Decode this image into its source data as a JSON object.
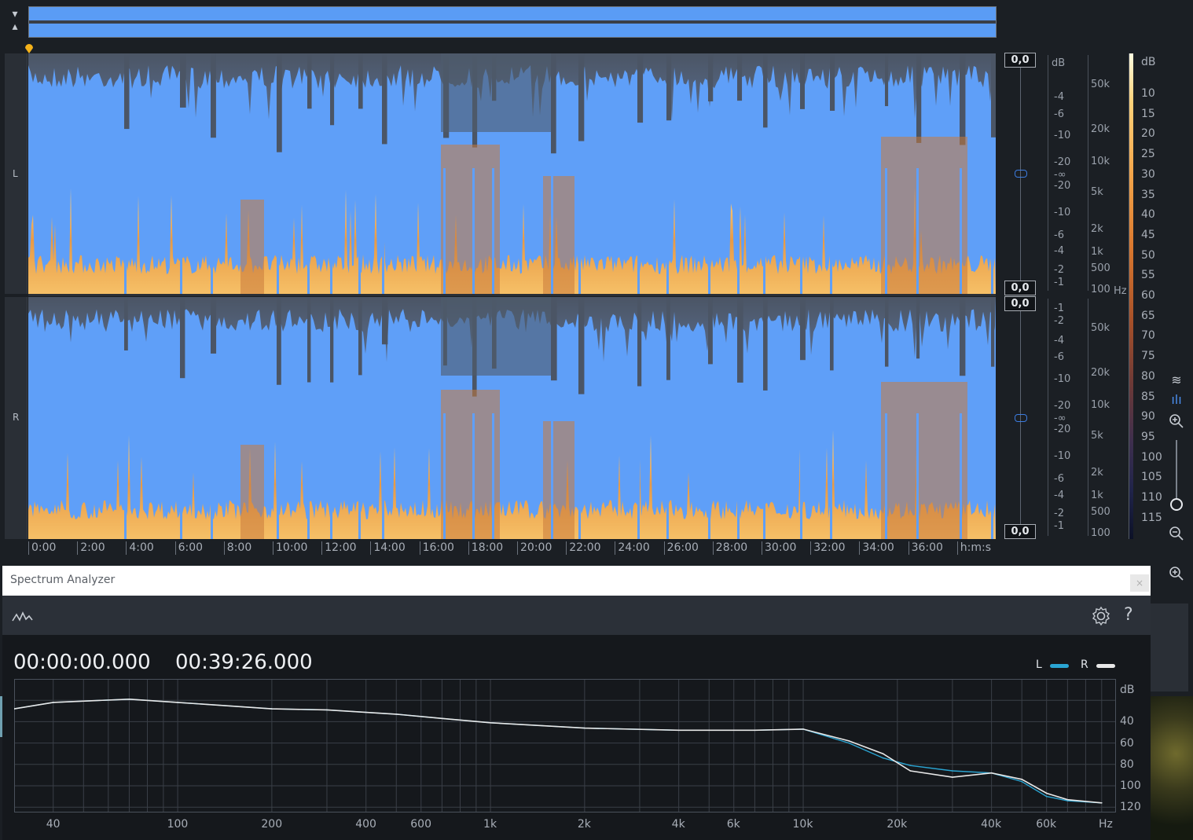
{
  "channels": [
    {
      "label": "L",
      "db_top": "0,0",
      "db_bottom": "0,0"
    },
    {
      "label": "R",
      "db_top": "0,0",
      "db_bottom": "0,0"
    }
  ],
  "db_ticks_L": [
    "dB",
    "-4",
    "-6",
    "-10",
    "-20",
    "-∞",
    "-20",
    "-10",
    "-6",
    "-4",
    "-2",
    "-1"
  ],
  "db_ticks_R": [
    "-1",
    "-2",
    "-4",
    "-6",
    "-10",
    "-20",
    "-∞",
    "-20",
    "-10",
    "-6",
    "-4",
    "-2",
    "-1"
  ],
  "hz_ticks_L": [
    "50k",
    "20k",
    "10k",
    "5k",
    "2k",
    "1k",
    "500",
    "100",
    "Hz"
  ],
  "hz_ticks_R": [
    "50k",
    "20k",
    "10k",
    "5k",
    "2k",
    "1k",
    "500",
    "100"
  ],
  "time_ruler": [
    "0:00",
    "2:00",
    "4:00",
    "6:00",
    "8:00",
    "10:00",
    "12:00",
    "14:00",
    "16:00",
    "18:00",
    "20:00",
    "22:00",
    "24:00",
    "26:00",
    "28:00",
    "30:00",
    "32:00",
    "34:00",
    "36:00",
    "h:m:s"
  ],
  "colorbar": {
    "unit": "dB",
    "ticks": [
      "10",
      "15",
      "20",
      "25",
      "30",
      "35",
      "40",
      "45",
      "50",
      "55",
      "60",
      "65",
      "70",
      "75",
      "80",
      "85",
      "90",
      "95",
      "100",
      "105",
      "110",
      "115"
    ]
  },
  "spectrum_analyzer": {
    "title": "Spectrum Analyzer",
    "close_label": "×",
    "help_label": "?",
    "start_time": "00:00:00.000",
    "end_time": "00:39:26.000",
    "legend": [
      {
        "name": "L",
        "color": "#2aa5d3"
      },
      {
        "name": "R",
        "color": "#e8e8e8"
      }
    ],
    "db_unit": "dB",
    "db_ticks": [
      "40",
      "60",
      "80",
      "100",
      "120"
    ],
    "freq_ticks": [
      "40",
      "100",
      "200",
      "400",
      "600",
      "1k",
      "2k",
      "4k",
      "6k",
      "10k",
      "20k",
      "40k",
      "60k",
      "Hz"
    ]
  },
  "chart_data": {
    "type": "line",
    "xlabel": "Hz",
    "ylabel": "dB",
    "x_scale": "log",
    "x": [
      30,
      40,
      70,
      100,
      200,
      300,
      500,
      700,
      1000,
      2000,
      4000,
      7000,
      10000,
      14000,
      18000,
      22000,
      30000,
      40000,
      50000,
      60000,
      70000,
      90000
    ],
    "series": [
      {
        "name": "L",
        "values": [
          28,
          22,
          19,
          22,
          28,
          29,
          33,
          37,
          41,
          46,
          48,
          48,
          47,
          60,
          74,
          81,
          86,
          88,
          96,
          110,
          114,
          116
        ]
      },
      {
        "name": "R",
        "values": [
          28,
          22,
          19,
          22,
          28,
          29,
          33,
          37,
          41,
          46,
          48,
          48,
          47,
          58,
          70,
          86,
          92,
          88,
          94,
          107,
          113,
          116
        ]
      }
    ],
    "ylim": [
      0,
      125
    ],
    "grid": true,
    "legend_position": "top-right"
  },
  "side_tools": [
    "waveform-icon",
    "spectrum-icon",
    "zoom-in-icon",
    "zoom-slider",
    "zoom-out-icon",
    "zoom-in-icon"
  ]
}
